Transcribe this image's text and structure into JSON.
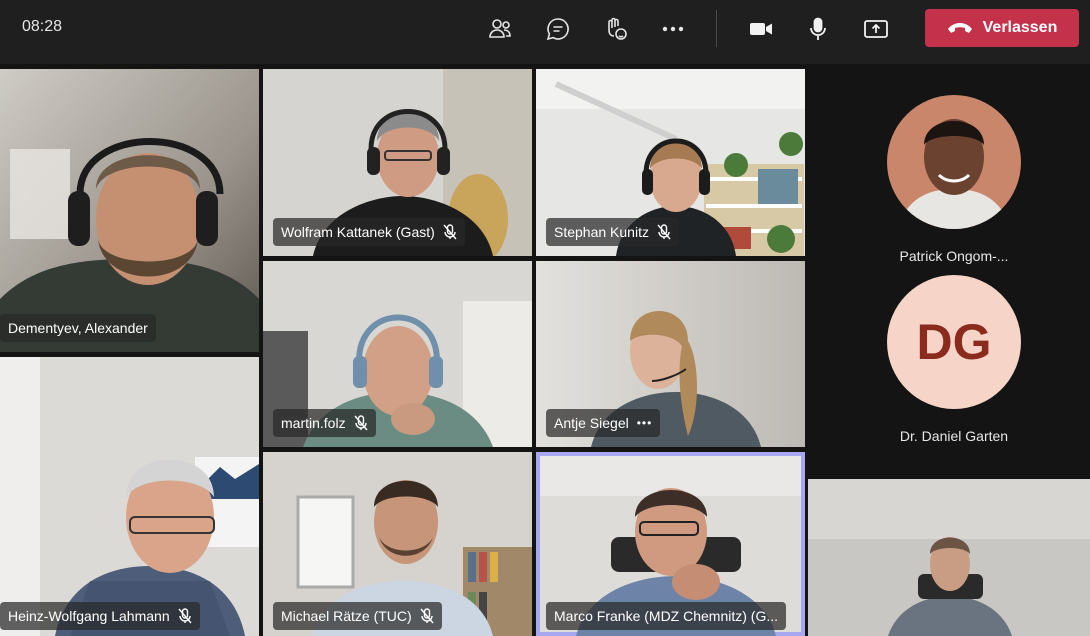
{
  "toolbar": {
    "time": "08:28",
    "leave_label": "Verlassen",
    "buttons": [
      "people-icon",
      "chat-icon",
      "raise-hand-icon",
      "more-icon",
      "camera-icon",
      "microphone-icon",
      "share-icon"
    ]
  },
  "participants": [
    {
      "name": "Dementyev, Alexander",
      "muted": false
    },
    {
      "name": "Wolfram Kattanek (Gast)",
      "muted": true
    },
    {
      "name": "Stephan Kunitz",
      "muted": true
    },
    {
      "name": "martin.folz",
      "muted": true
    },
    {
      "name": "Antje Siegel",
      "muted": false,
      "more": "•••"
    },
    {
      "name": "Heinz-Wolfgang Lahmann",
      "muted": true
    },
    {
      "name": "Michael Rätze (TUC)",
      "muted": true
    },
    {
      "name": "Marco Franke (MDZ Chemnitz) (G...",
      "muted": false,
      "active_speaker": true
    }
  ],
  "sidebar": {
    "people": [
      {
        "name": "Patrick Ongom-...",
        "initials": ""
      },
      {
        "name": "Dr. Daniel Garten",
        "initials": "DG"
      }
    ]
  },
  "colors": {
    "leave": "#c4314b",
    "active_border": "#a8a8f0",
    "dg_bg": "#f6d4c8",
    "dg_text": "#8a2b1d"
  }
}
